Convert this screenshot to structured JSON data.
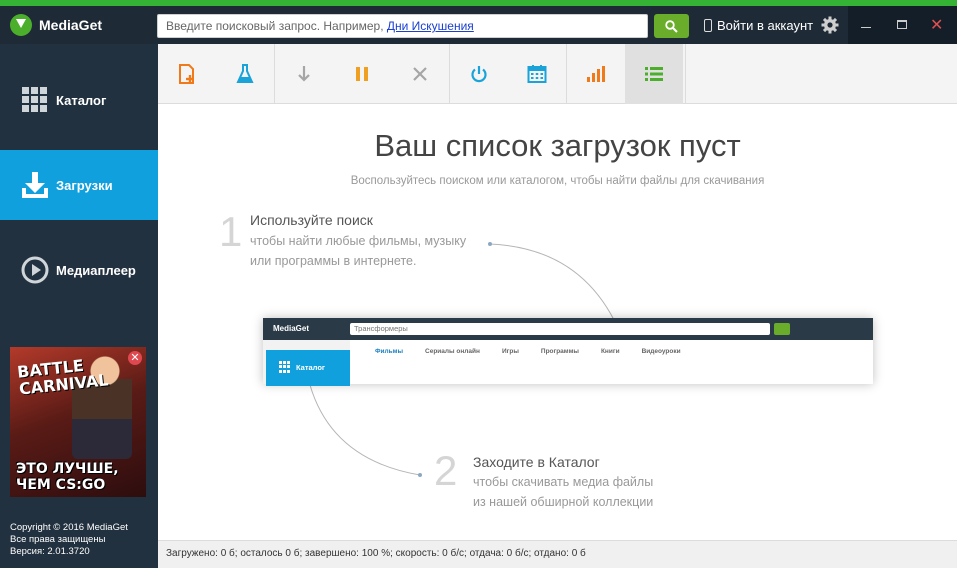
{
  "app": {
    "name": "MediaGet"
  },
  "search": {
    "placeholder_text": "Введите поисковый запрос. Например, ",
    "placeholder_link": "Дни Искушения"
  },
  "header": {
    "login_label": "Войти в аккаунт"
  },
  "sidebar": {
    "items": [
      {
        "label": "Каталог",
        "icon": "grid-icon",
        "active": false
      },
      {
        "label": "Загрузки",
        "icon": "download-icon",
        "active": true
      },
      {
        "label": "Медиаплеер",
        "icon": "play-icon",
        "active": false
      }
    ],
    "ad": {
      "title_line1": "BATTLE",
      "title_line2": "CARNIVAL",
      "slogan_line1": "ЭТО ЛУЧШЕ,",
      "slogan_line2": "ЧЕМ CS:GO"
    },
    "copyright": {
      "line1": "Copyright © 2016 MediaGet",
      "line2": "Все права защищены",
      "line3": "Версия: 2.01.3720"
    }
  },
  "toolbar": {
    "buttons": [
      {
        "icon": "new-file-icon",
        "color": "#f07a1a"
      },
      {
        "icon": "flask-icon",
        "color": "#1aa3d8"
      },
      {
        "icon": "arrow-down-icon",
        "color": "#a6a6a6"
      },
      {
        "icon": "pause-icon",
        "color": "#f0a020"
      },
      {
        "icon": "close-x-icon",
        "color": "#a6a6a6"
      },
      {
        "icon": "power-icon",
        "color": "#1aa3d8"
      },
      {
        "icon": "calendar-icon",
        "color": "#1aa3d8"
      },
      {
        "icon": "bar-chart-icon",
        "color": "#f07a1a"
      },
      {
        "icon": "list-icon",
        "color": "#4caf2c"
      }
    ]
  },
  "main": {
    "title": "Ваш список загрузок пуст",
    "subtitle": "Воспользуйтесь поиском или каталогом, чтобы найти файлы для скачивания",
    "step1": {
      "number": "1",
      "title": "Используйте поиск",
      "desc_line1": "чтобы найти любые фильмы, музыку",
      "desc_line2": "или программы в интернете."
    },
    "step2": {
      "number": "2",
      "title": "Заходите в Каталог",
      "desc_line1": "чтобы скачивать медиа файлы",
      "desc_line2": "из нашей обширной коллекции"
    },
    "preview": {
      "logo": "MediaGet",
      "search_text": "Трансформеры",
      "catalog_label": "Каталог",
      "tabs": [
        "Фильмы",
        "Сериалы онлайн",
        "Игры",
        "Программы",
        "Книги",
        "Видеоуроки"
      ]
    }
  },
  "status": {
    "text": "Загружено: 0 б; осталось 0 б; завершено: 100 %; скорость: 0 б/с; отдача: 0 б/с; отдано: 0 б"
  },
  "colors": {
    "accent_blue": "#10a0de",
    "sidebar_bg": "#22313f",
    "top_stripe": "#35b335",
    "search_button": "#6aad2b"
  }
}
